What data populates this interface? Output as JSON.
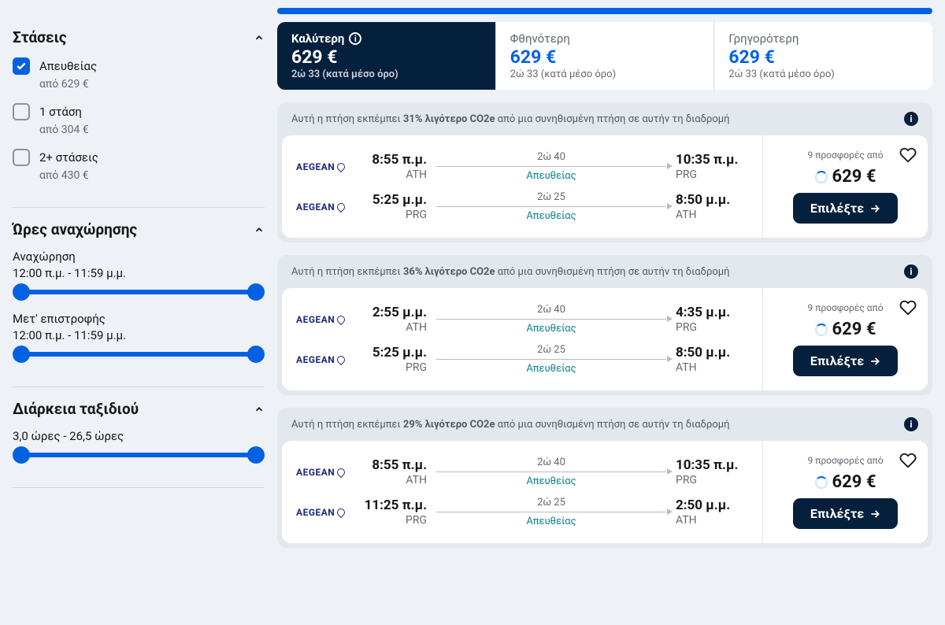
{
  "filters": {
    "stops": {
      "title": "Στάσεις",
      "options": [
        {
          "label": "Απευθείας",
          "sub": "από 629 €",
          "checked": true
        },
        {
          "label": "1 στάση",
          "sub": "από 304 €",
          "checked": false
        },
        {
          "label": "2+ στάσεις",
          "sub": "από 430 €",
          "checked": false
        }
      ]
    },
    "times": {
      "title": "Ώρες αναχώρησης",
      "departure_label": "Αναχώρηση",
      "departure_range": "12:00 π.μ. - 11:59 μ.μ.",
      "return_label": "Μετ' επιστροφής",
      "return_range": "12:00 π.μ. - 11:59 μ.μ."
    },
    "duration": {
      "title": "Διάρκεια ταξιδιού",
      "range": "3,0 ώρες - 26,5 ώρες"
    }
  },
  "sort": {
    "tabs": [
      {
        "title": "Καλύτερη",
        "price": "629 €",
        "sub": "2ώ 33 (κατά μέσο όρο)",
        "active": true,
        "info": true
      },
      {
        "title": "Φθηνότερη",
        "price": "629 €",
        "sub": "2ώ 33 (κατά μέσο όρο)",
        "active": false
      },
      {
        "title": "Γρηγορότερη",
        "price": "629 €",
        "sub": "2ώ 33 (κατά μέσο όρο)",
        "active": false
      }
    ]
  },
  "results": [
    {
      "eco_prefix": "Αυτή η πτήση εκπέμπει ",
      "eco_bold": "31% λιγότερο CO2e",
      "eco_suffix": " από μια συνηθισμένη πτήση σε αυτήν τη διαδρομή",
      "legs": [
        {
          "airline": "AEGEAN",
          "dep_time": "8:55 π.μ.",
          "dep_code": "ATH",
          "duration": "2ώ 40",
          "direct": "Απευθείας",
          "arr_time": "10:35 π.μ.",
          "arr_code": "PRG"
        },
        {
          "airline": "AEGEAN",
          "dep_time": "5:25 μ.μ.",
          "dep_code": "PRG",
          "duration": "2ώ 25",
          "direct": "Απευθείας",
          "arr_time": "8:50 μ.μ.",
          "arr_code": "ATH"
        }
      ],
      "offers": "9 προσφορές από",
      "price": "629 €",
      "select": "Επιλέξτε"
    },
    {
      "eco_prefix": "Αυτή η πτήση εκπέμπει ",
      "eco_bold": "36% λιγότερο CO2e",
      "eco_suffix": " από μια συνηθισμένη πτήση σε αυτήν τη διαδρομή",
      "legs": [
        {
          "airline": "AEGEAN",
          "dep_time": "2:55 μ.μ.",
          "dep_code": "ATH",
          "duration": "2ώ 40",
          "direct": "Απευθείας",
          "arr_time": "4:35 μ.μ.",
          "arr_code": "PRG"
        },
        {
          "airline": "AEGEAN",
          "dep_time": "5:25 μ.μ.",
          "dep_code": "PRG",
          "duration": "2ώ 25",
          "direct": "Απευθείας",
          "arr_time": "8:50 μ.μ.",
          "arr_code": "ATH"
        }
      ],
      "offers": "9 προσφορές από",
      "price": "629 €",
      "select": "Επιλέξτε"
    },
    {
      "eco_prefix": "Αυτή η πτήση εκπέμπει ",
      "eco_bold": "29% λιγότερο CO2e",
      "eco_suffix": " από μια συνηθισμένη πτήση σε αυτήν τη διαδρομή",
      "legs": [
        {
          "airline": "AEGEAN",
          "dep_time": "8:55 π.μ.",
          "dep_code": "ATH",
          "duration": "2ώ 40",
          "direct": "Απευθείας",
          "arr_time": "10:35 π.μ.",
          "arr_code": "PRG"
        },
        {
          "airline": "AEGEAN",
          "dep_time": "11:25 π.μ.",
          "dep_code": "PRG",
          "duration": "2ώ 25",
          "direct": "Απευθείας",
          "arr_time": "2:50 μ.μ.",
          "arr_code": "ATH"
        }
      ],
      "offers": "9 προσφορές από",
      "price": "629 €",
      "select": "Επιλέξτε"
    }
  ]
}
